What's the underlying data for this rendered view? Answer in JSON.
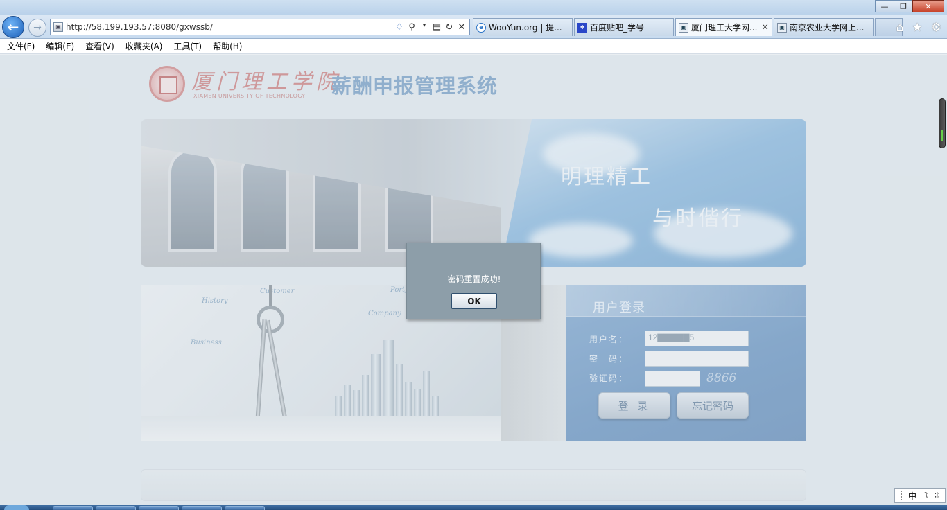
{
  "browser": {
    "address_url": "http://58.199.193.57:8080/gxwssb/",
    "tabs": [
      {
        "label": "WooYun.org | 提...",
        "icon": "ie-icon",
        "active": false
      },
      {
        "label": "百度贴吧_学号",
        "icon": "baidu-paw-icon",
        "active": false
      },
      {
        "label": "厦门理工大学网...",
        "icon": "page-icon",
        "active": true
      },
      {
        "label": "南京农业大学网上...",
        "icon": "page-icon",
        "active": false
      }
    ],
    "tab_close": "×",
    "window_controls": {
      "minimize": "—",
      "maximize": "❐",
      "close": "✕"
    }
  },
  "menubar": {
    "items": [
      "文件(F)",
      "编辑(E)",
      "查看(V)",
      "收藏夹(A)",
      "工具(T)",
      "帮助(H)"
    ]
  },
  "page": {
    "logo": {
      "cn": "厦门理工学院",
      "en": "XIAMEN UNIVERSITY OF TECHNOLOGY"
    },
    "system_title": "薪酬申报管理系统",
    "motto_line1": "明理精工",
    "motto_line2": "与时偕行",
    "deco_words": [
      "History",
      "Customer",
      "Company",
      "Business",
      "Portf"
    ],
    "login": {
      "title": "用户登录",
      "username_label": "用户名：",
      "username_value": "12▇▇▇▇▇5",
      "password_label": "密　码：",
      "password_value": "",
      "captcha_label": "验证码：",
      "captcha_value": "",
      "captcha_code": "8866",
      "login_button": "登 录",
      "forgot_button": "忘记密码"
    }
  },
  "dialog": {
    "message": "密码重置成功!",
    "ok_button": "OK"
  },
  "ime": {
    "mode": "中",
    "moon": "☽",
    "punct": "⁜"
  },
  "colors": {
    "system_title": "#7ea3c8",
    "login_panel": "#7aa0c9",
    "dialog_bg": "#8d9ea9"
  }
}
